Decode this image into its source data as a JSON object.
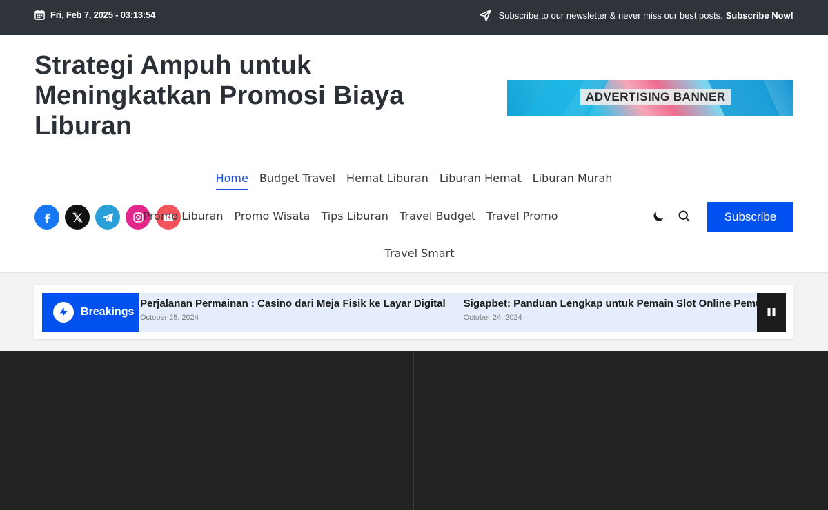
{
  "topbar": {
    "datetime": "Fri, Feb 7, 2025 - 03:13:54",
    "newsletter_text": "Subscribe to our newsletter & never miss our best posts.",
    "newsletter_link": "Subscribe Now!"
  },
  "header": {
    "site_title": "Strategi Ampuh untuk Meningkatkan Promosi Biaya Liburan",
    "ad_banner_label": "ADVERTISING BANNER"
  },
  "socials": [
    "facebook-icon",
    "x-icon",
    "telegram-icon",
    "instagram-icon",
    "youtube-icon"
  ],
  "nav": {
    "row1": [
      "Home",
      "Budget Travel",
      "Hemat Liburan",
      "Liburan Hemat",
      "Liburan Murah"
    ],
    "row2": [
      "Promo Liburan",
      "Promo Wisata",
      "Tips Liburan",
      "Travel Budget",
      "Travel Promo"
    ],
    "row3": [
      "Travel Smart"
    ],
    "active": "Home",
    "subscribe_label": "Subscribe"
  },
  "breaking": {
    "label": "Breakings",
    "items": [
      {
        "title": "Perjalanan Permainan : Casino dari Meja Fisik ke Layar Digital",
        "date": "October 25, 2024"
      },
      {
        "title": "Sigapbet: Panduan Lengkap untuk Pemain Slot Online Pemula",
        "date": "October 24, 2024"
      }
    ]
  },
  "colors": {
    "accent": "#0051f0",
    "topbar_bg": "#2f333a",
    "dark_section": "#222222"
  }
}
